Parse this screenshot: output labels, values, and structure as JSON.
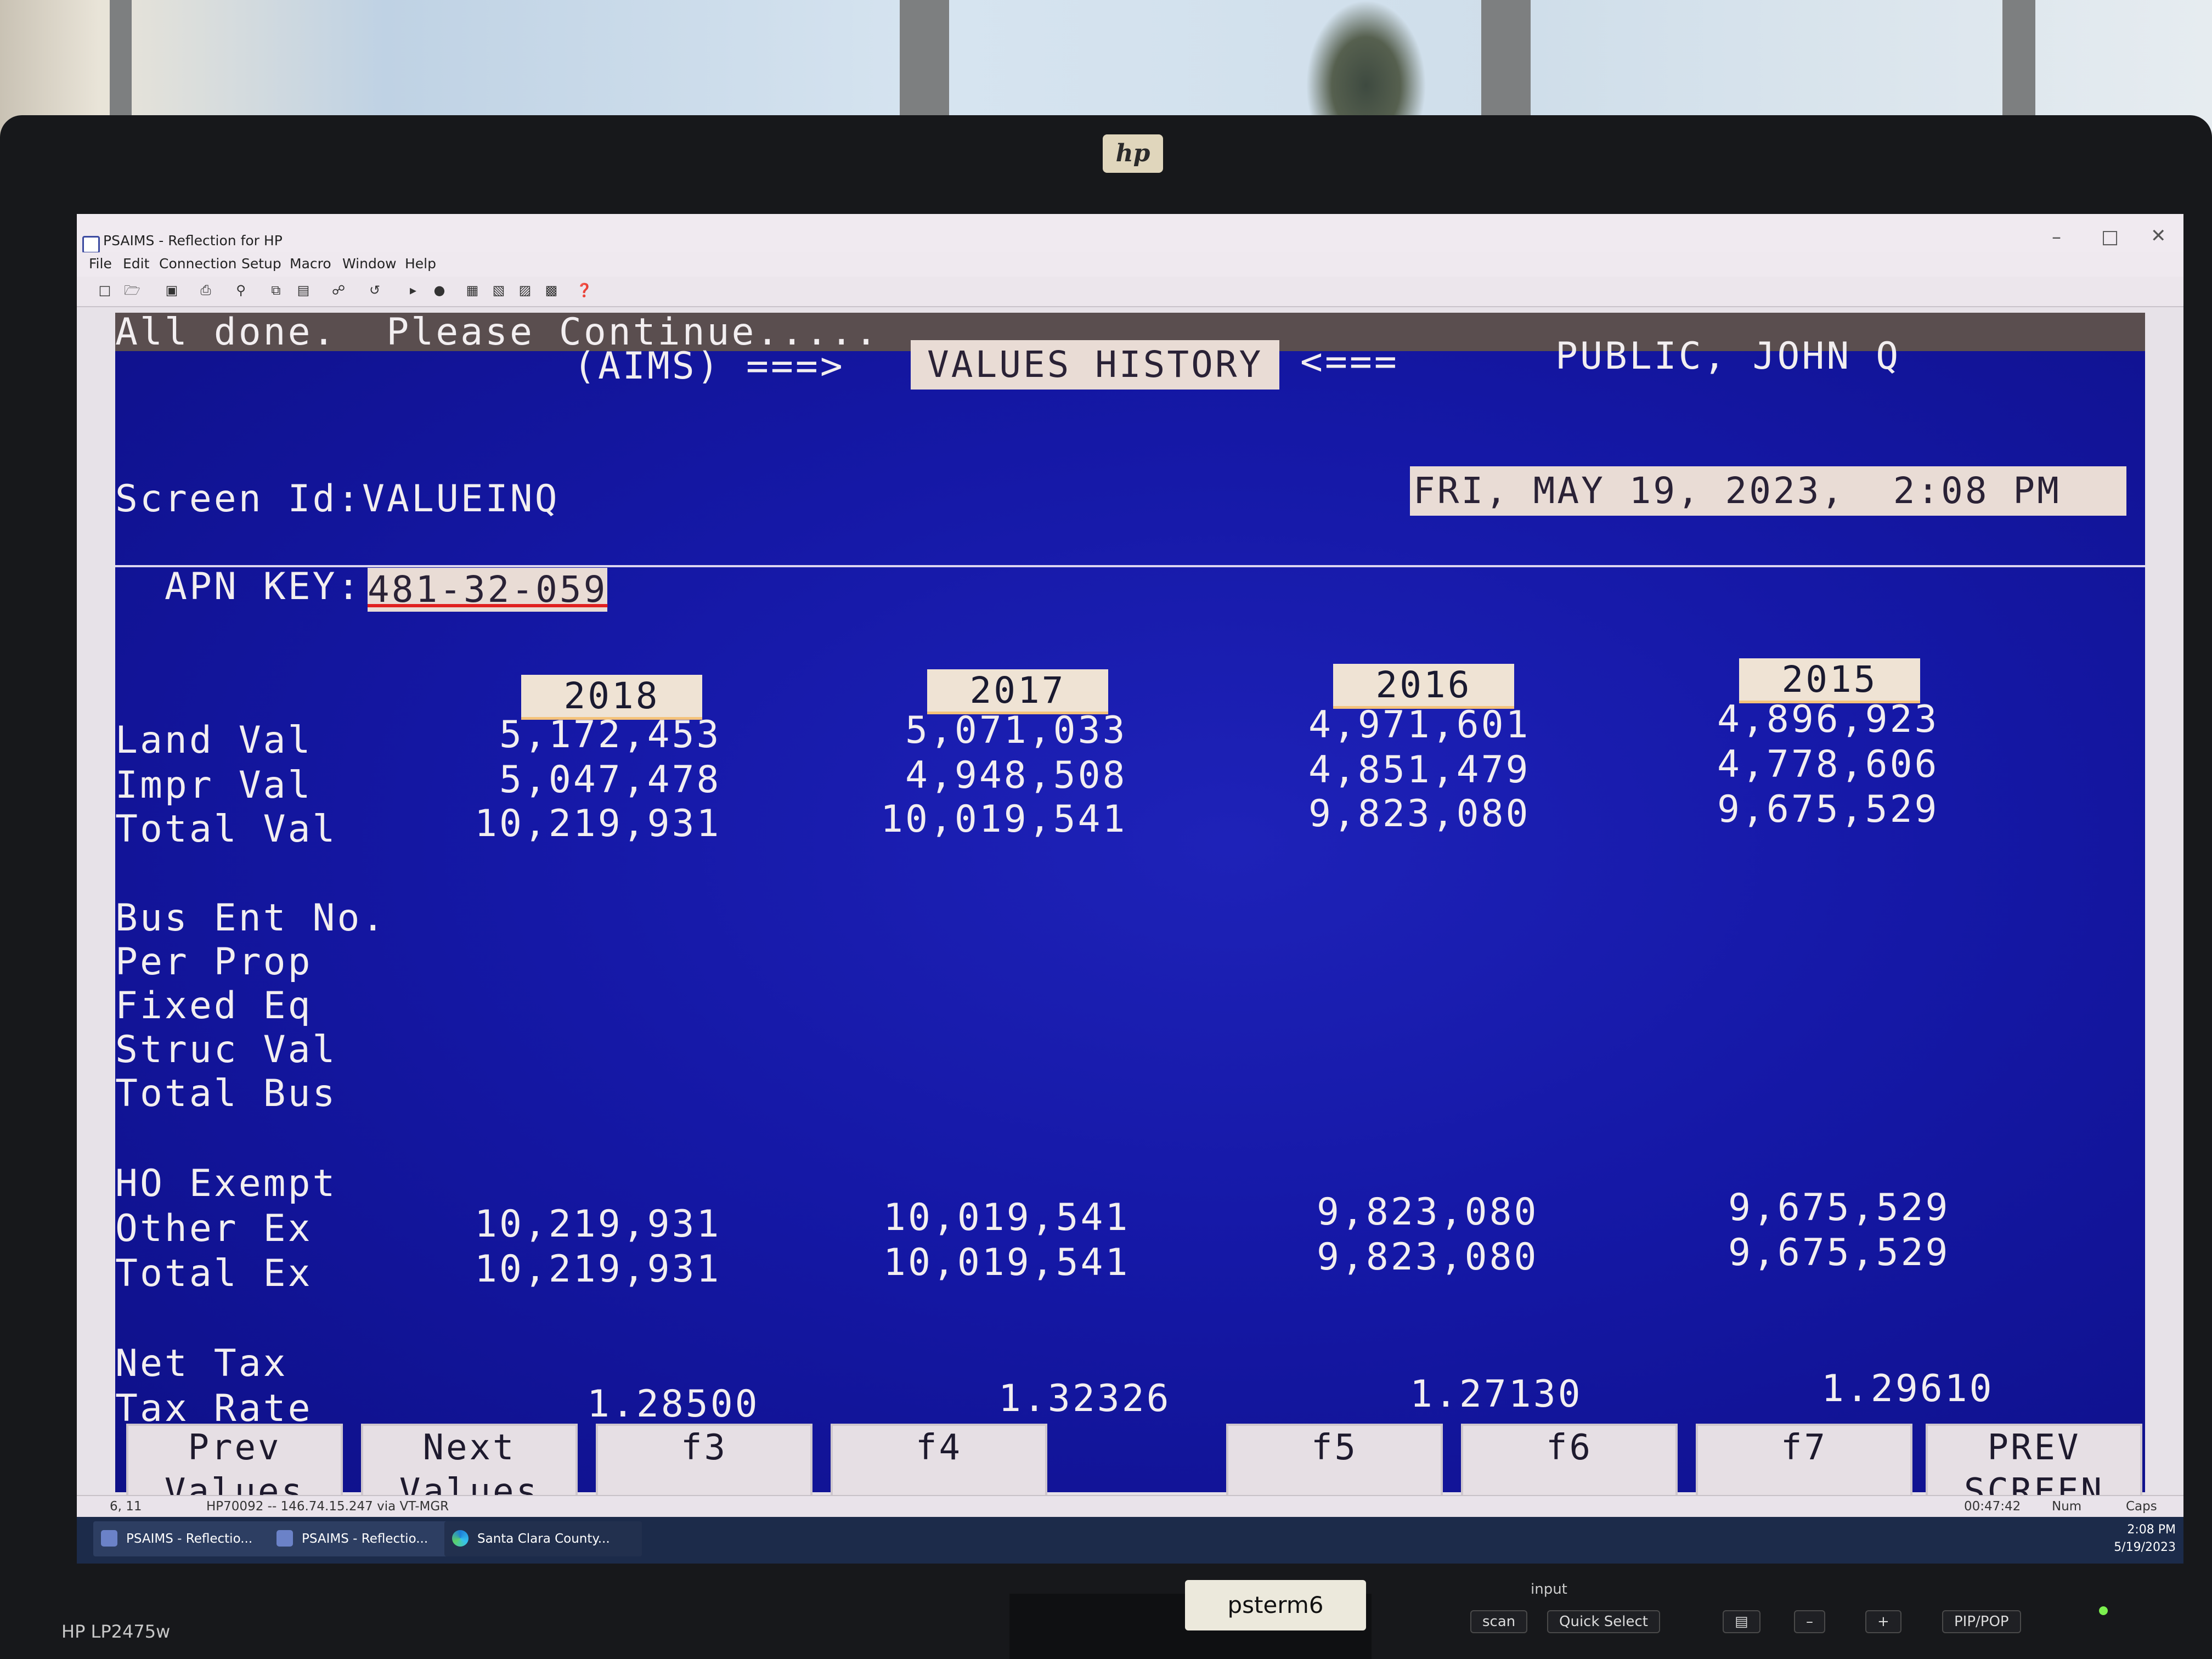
{
  "window": {
    "title": "PSAIMS - Reflection for HP",
    "controls": [
      "–",
      "□",
      "✕"
    ]
  },
  "menu": [
    "File",
    "Edit",
    "Connection",
    "Setup",
    "Macro",
    "Window",
    "Help"
  ],
  "terminal": {
    "message": "All done.  Please Continue.....",
    "system": "(AIMS)",
    "arrow_right": "===>",
    "screen_name": "VALUES HISTORY",
    "arrow_left": "<===",
    "owner": "PUBLIC, JOHN Q",
    "screen_id_label": "Screen Id:",
    "screen_id": "VALUEINQ",
    "datetime": "FRI, MAY 19, 2023,  2:08 PM",
    "apn_label": "APN KEY:",
    "apn_value": "481-32-059",
    "years": [
      "2018",
      "2017",
      "2016",
      "2015"
    ],
    "row_labels": {
      "land": "Land Val",
      "impr": "Impr Val",
      "total": "Total Val",
      "bus_ent": "Bus Ent No.",
      "per_prop": "Per Prop",
      "fixed_eq": "Fixed Eq",
      "struc": "Struc Val",
      "total_bus": "Total Bus",
      "ho_exempt": "HO Exempt",
      "other_ex": "Other Ex",
      "total_ex": "Total Ex",
      "net_tax": "Net Tax",
      "tax_rate": "Tax Rate"
    },
    "columns": [
      {
        "land": "5,172,453",
        "impr": "5,047,478",
        "total": "10,219,931",
        "other_ex": "10,219,931",
        "total_ex": "10,219,931",
        "tax_rate": "1.28500"
      },
      {
        "land": "5,071,033",
        "impr": "4,948,508",
        "total": "10,019,541",
        "other_ex": "10,019,541",
        "total_ex": "10,019,541",
        "tax_rate": "1.32326"
      },
      {
        "land": "4,971,601",
        "impr": "4,851,479",
        "total": "9,823,080",
        "other_ex": "9,823,080",
        "total_ex": "9,823,080",
        "tax_rate": "1.27130"
      },
      {
        "land": "4,896,923",
        "impr": "4,778,606",
        "total": "9,675,529",
        "other_ex": "9,675,529",
        "total_ex": "9,675,529",
        "tax_rate": "1.29610"
      }
    ],
    "function_keys": [
      "Prev\nValues",
      "Next\nValues",
      "f3",
      "f4",
      "f5",
      "f6",
      "f7",
      "PREV\nSCREEN"
    ]
  },
  "statusbar": {
    "cursor": "6, 11",
    "connection": "HP70092 -- 146.74.15.247 via VT-MGR",
    "elapsed": "00:47:42",
    "num": "Num",
    "caps": "Caps"
  },
  "taskbar": {
    "items": [
      "PSAIMS - Reflectio...",
      "PSAIMS - Reflectio...",
      "Santa Clara County..."
    ],
    "time": "2:08 PM",
    "date": "5/19/2023"
  },
  "monitor": {
    "brand": "hp",
    "model": "HP LP2475w",
    "input_name": "psterm6",
    "input_label": "input",
    "buttons": [
      "scan",
      "Quick Select",
      "–",
      "+",
      "PIP/POP"
    ]
  },
  "colors": {
    "terminal_bg": "#1518a6",
    "terminal_fg": "#f2eef0",
    "reverse_bg": "#e9dcd5",
    "year_underline": "#f4c27a"
  },
  "icons": [
    "new-file-icon",
    "open-folder-icon",
    "save-icon",
    "print-icon",
    "find-icon",
    "copy-icon",
    "paste-icon",
    "connect-icon",
    "macro-icon",
    "play-icon",
    "record-icon",
    "help-icon"
  ]
}
